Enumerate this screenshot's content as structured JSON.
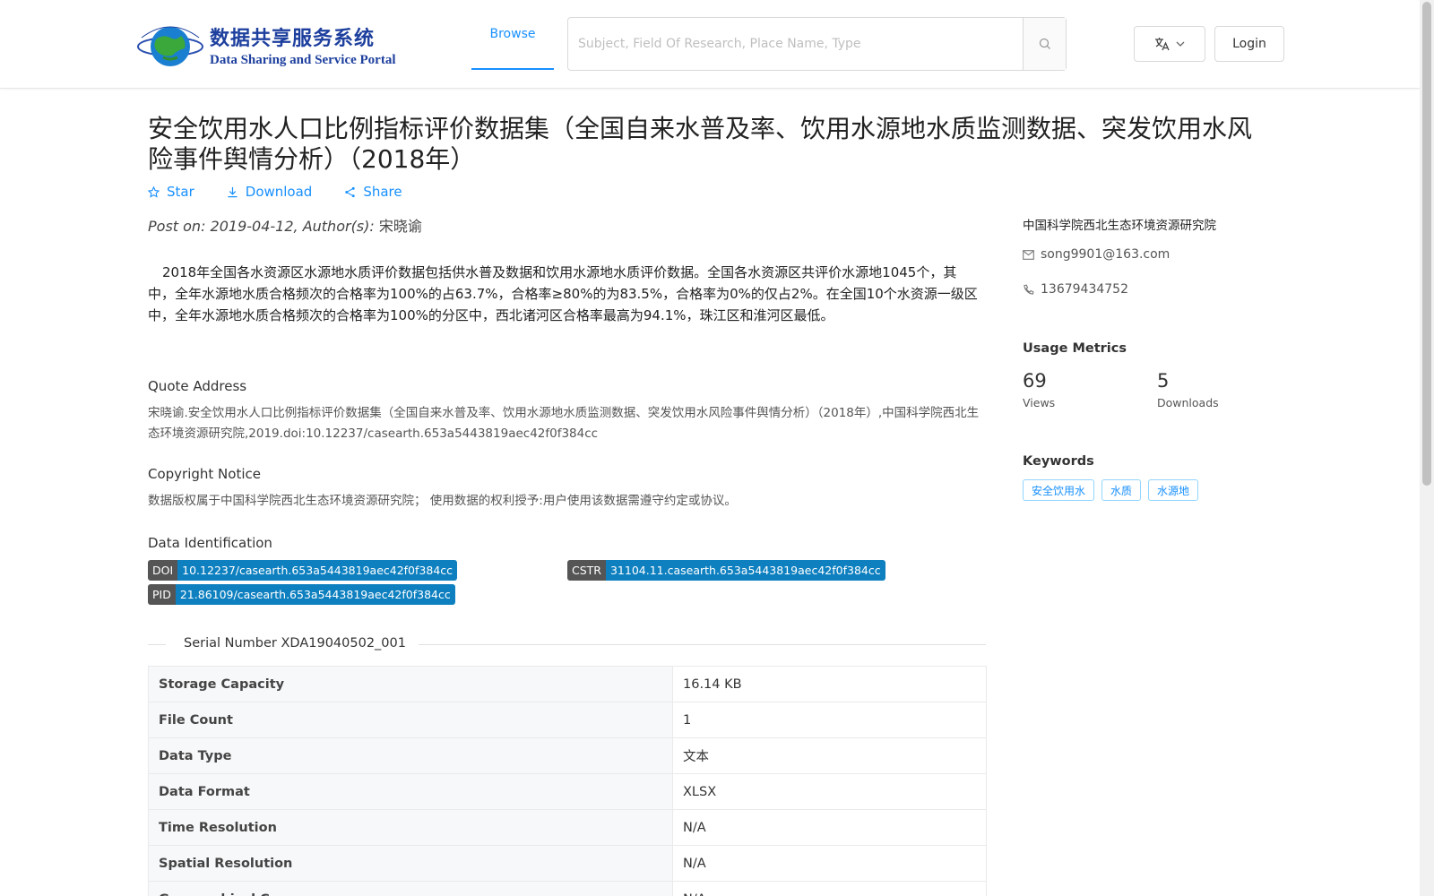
{
  "header": {
    "logo_cn": "数据共享服务系统",
    "logo_en": "Data Sharing and Service Portal",
    "nav_browse": "Browse",
    "search_placeholder": "Subject, Field Of Research, Place Name, Type",
    "login": "Login"
  },
  "dataset": {
    "title": "安全饮用水人口比例指标评价数据集（全国自来水普及率、饮用水源地水质监测数据、突发饮用水风险事件舆情分析）（2018年）",
    "actions": {
      "star": "Star",
      "download": "Download",
      "share": "Share"
    },
    "post_label": "Post on: 2019-04-12, Author(s):",
    "author": "宋晓谕",
    "abstract": "2018年全国各水资源区水源地水质评价数据包括供水普及数据和饮用水源地水质评价数据。全国各水资源区共评价水源地1045个，其中，全年水源地水质合格频次的合格率为100%的占63.7%，合格率≥80%的为83.5%，合格率为0%的仅占2%。在全国10个水资源一级区中，全年水源地水质合格频次的合格率为100%的分区中，西北诸河区合格率最高为94.1%，珠江区和淮河区最低。",
    "quote_title": "Quote Address",
    "quote_text": "宋晓谕.安全饮用水人口比例指标评价数据集（全国自来水普及率、饮用水源地水质监测数据、突发饮用水风险事件舆情分析）（2018年）,中国科学院西北生态环境资源研究院,2019.doi:10.12237/casearth.653a5443819aec42f0f384cc",
    "copyright_title": "Copyright Notice",
    "copyright_text": "数据版权属于中国科学院西北生态环境资源研究院； 使用数据的权利授予:用户使用该数据需遵守约定或协议。",
    "ident_title": "Data Identification",
    "ids": {
      "doi_k": "DOI",
      "doi_v": "10.12237/casearth.653a5443819aec42f0f384cc",
      "cstr_k": "CSTR",
      "cstr_v": "31104.11.casearth.653a5443819aec42f0f384cc",
      "pid_k": "PID",
      "pid_v": "21.86109/casearth.653a5443819aec42f0f384cc"
    },
    "serial": "Serial Number XDA19040502_001",
    "table": [
      {
        "k": "Storage Capacity",
        "v": "16.14 KB"
      },
      {
        "k": "File Count",
        "v": "1"
      },
      {
        "k": "Data Type",
        "v": "文本"
      },
      {
        "k": "Data Format",
        "v": "XLSX"
      },
      {
        "k": "Time Resolution",
        "v": "N/A"
      },
      {
        "k": "Spatial Resolution",
        "v": "N/A"
      },
      {
        "k": "Geographical C...",
        "v": "N/A"
      }
    ]
  },
  "sidebar": {
    "org": "中国科学院西北生态环境资源研究院",
    "email": "song9901@163.com",
    "phone": "13679434752",
    "metrics_title": "Usage Metrics",
    "views": "69",
    "views_label": "Views",
    "downloads": "5",
    "downloads_label": "Downloads",
    "keywords_title": "Keywords",
    "keywords": [
      "安全饮用水",
      "水质",
      "水源地"
    ]
  },
  "colors": {
    "accent": "#1890ff",
    "badge_key": "#555555",
    "badge_value": "#0e80c0"
  },
  "icons": [
    "globe-logo-icon",
    "search-icon",
    "translate-icon",
    "chevron-down-icon",
    "star-icon",
    "download-icon",
    "share-icon",
    "mail-icon",
    "phone-icon"
  ]
}
